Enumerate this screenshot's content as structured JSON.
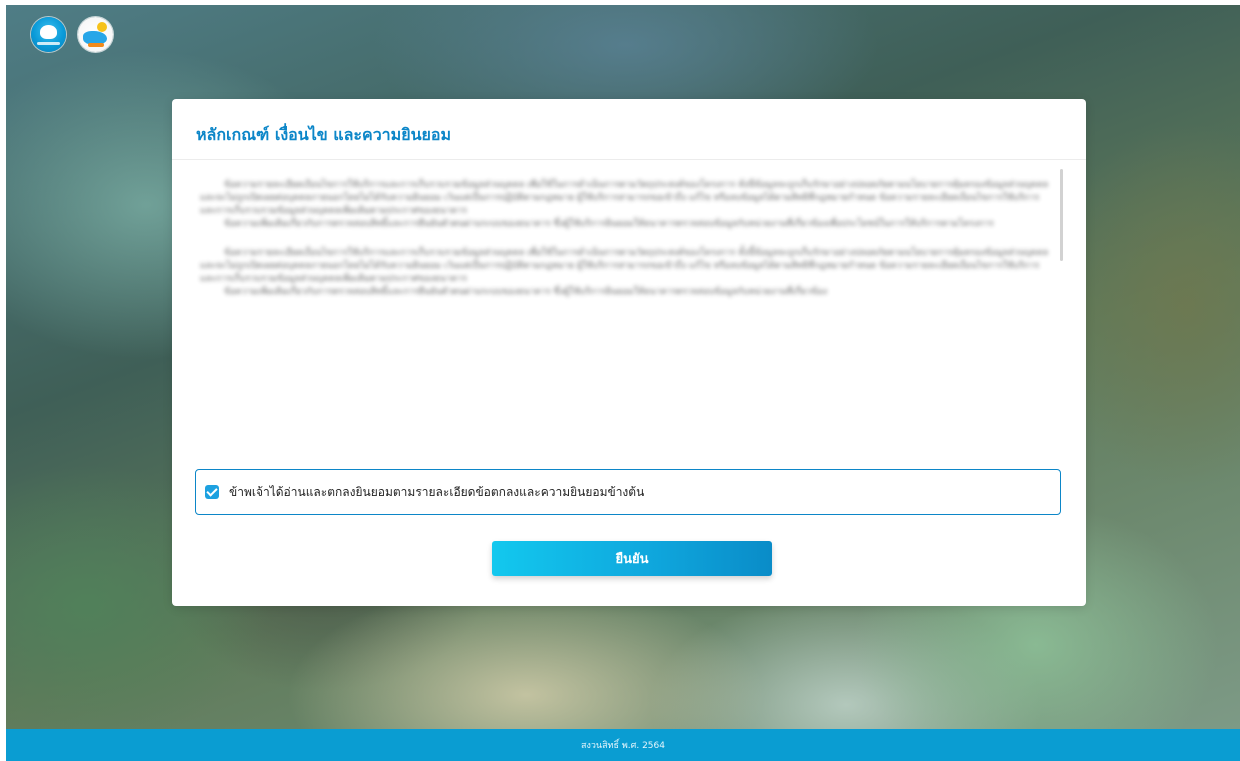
{
  "header": {
    "logos": [
      {
        "name": "krungthai-logo",
        "icon": "krungthai-bird-icon"
      },
      {
        "name": "campaign-logo",
        "icon": "campaign-sun-wave-icon"
      }
    ]
  },
  "modal": {
    "title": "หลักเกณฑ์ เงื่อนไข และความยินยอม",
    "consent_checked": true,
    "consent_label": "ข้าพเจ้าได้อ่านและตกลงยินยอมตามรายละเอียดข้อตกลงและความยินยอมข้างต้น",
    "confirm_label": "ยืนยัน"
  },
  "footer": {
    "text": "สงวนสิทธิ์ พ.ศ. 2564"
  },
  "colors": {
    "accent": "#0c86c8",
    "button_start": "#13c8ee",
    "button_end": "#0a8cc8",
    "footer_bg": "#0a9dd2"
  }
}
